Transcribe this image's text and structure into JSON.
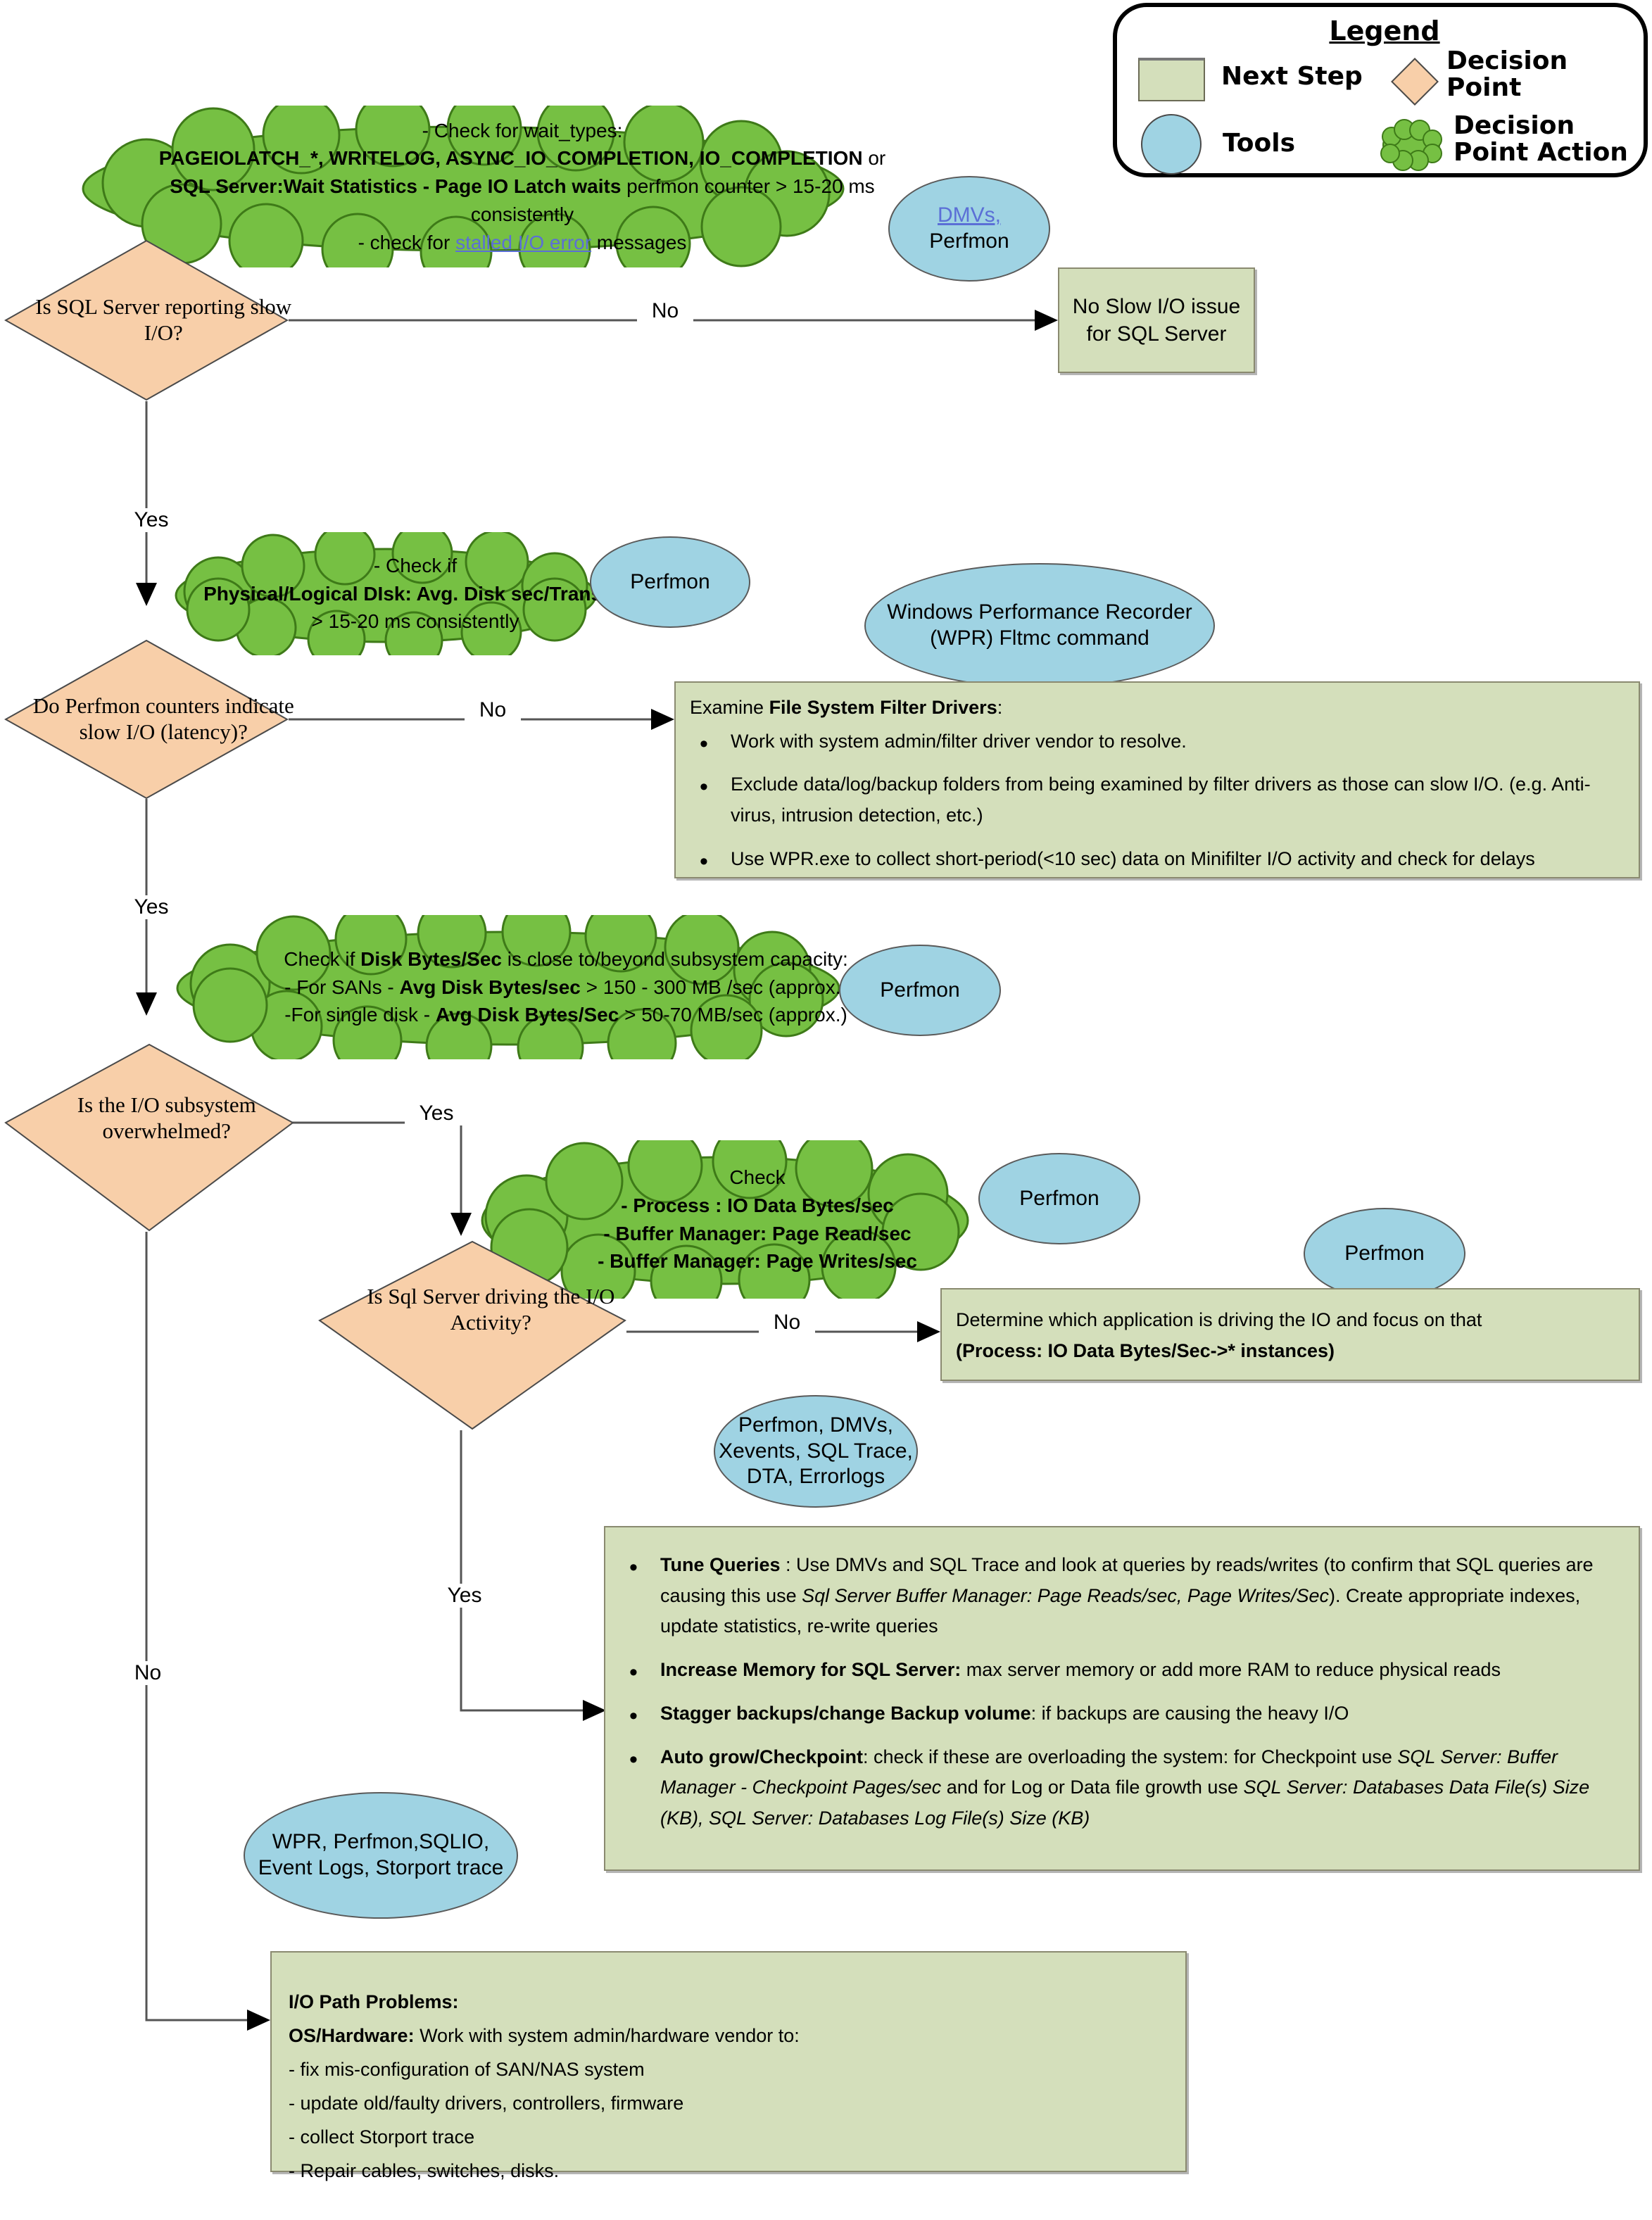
{
  "legend": {
    "title": "Legend",
    "items": [
      {
        "shape": "rect",
        "label": "Next Step"
      },
      {
        "shape": "diamond",
        "label": "Decision Point"
      },
      {
        "shape": "circle",
        "label": "Tools"
      },
      {
        "shape": "cloud",
        "label": "Decision Point Action"
      }
    ],
    "colors": {
      "next_step": "#d4dfbb",
      "tools": "#9fd3e3",
      "decision_point": "#f8cfa9",
      "decision_point_action": "#76c043"
    }
  },
  "clouds": {
    "wait_types": {
      "line1": "- Check for wait_types:",
      "line2_bold": "PAGEIOLATCH_*,  WRITELOG, ASYNC_IO_COMPLETION, IO_COMPLETION",
      "line2_tail": " or",
      "line3_bold": "SQL Server:Wait Statistics - Page IO Latch waits",
      "line3_tail": " perfmon counter > 15-20 ms",
      "line4": "consistently",
      "line5_pre": "- check for ",
      "line5_link": "stalled I/O error",
      "line5_post": " messages"
    },
    "disk_latency": {
      "line1": "- Check if",
      "line2_bold": "Physical/Logical DIsk: Avg. Disk sec/Transfer",
      "line3": "> 15-20 ms consistently"
    },
    "disk_bytes": {
      "line1_pre": "Check if ",
      "line1_bold": "Disk Bytes/Sec",
      "line1_post": " is close to/beyond subsystem capacity:",
      "line2_pre": "- For SANs - ",
      "line2_bold": "Avg Disk Bytes/sec",
      "line2_post": " > 150 - 300 MB /sec   (approx.)",
      "line3_pre": "-For single disk - ",
      "line3_bold": "Avg Disk Bytes/Sec",
      "line3_post": " > 50-70 MB/sec (approx.)"
    },
    "sql_counters": {
      "line1": "Check",
      "line2": "- Process : IO Data Bytes/sec",
      "line3": "- Buffer Manager: Page Read/sec",
      "line4": "- Buffer Manager: Page Writes/sec"
    }
  },
  "decisions": {
    "slow_io": "Is SQL Server reporting slow I/O?",
    "perfmon_latency": "Do Perfmon counters indicate slow I/O (latency)?",
    "overwhelmed": "Is the I/O subsystem overwhelmed?",
    "sql_driving": "Is Sql Server driving the I/O Activity?"
  },
  "tools": {
    "dmvs_perfmon_link": "DMVs,",
    "dmvs_perfmon_rest": "Perfmon",
    "perfmon_1": "Perfmon",
    "wpr": "Windows Performance Recorder (WPR) Fltmc command",
    "perfmon_2": "Perfmon",
    "perfmon_3": "Perfmon",
    "perfmon_4": "Perfmon",
    "sql_tools": "Perfmon, DMVs, Xevents, SQL Trace, DTA, Errorlogs",
    "wpr_tools": "WPR, Perfmon,SQLIO, Event Logs, Storport trace"
  },
  "boxes": {
    "no_slow_io": "No Slow I/O issue for SQL Server",
    "filter_drivers": {
      "heading_pre": "Examine ",
      "heading_bold": "File System Filter Drivers",
      "heading_post": ":",
      "bullets": [
        "Work with system admin/filter driver vendor to resolve.",
        "Exclude data/log/backup folders from being examined by filter drivers as those can slow I/O. (e.g. Anti-virus, intrusion detection, etc.)",
        "Use WPR.exe to collect short-period(<10 sec) data on Minifilter I/O activity and check for delays"
      ]
    },
    "other_app": {
      "line1": "Determine which application is driving the IO and focus on that",
      "line2_bold": "(Process: IO Data Bytes/Sec->* instances)"
    },
    "tune": {
      "bullets": [
        {
          "bold": "Tune Queries",
          "text_a": " : Use DMVs and SQL Trace and look at queries by reads/writes (to   confirm that SQL queries are causing this use ",
          "italic": "Sql Server Buffer Manager: Page Reads/sec, Page Writes/Sec",
          "text_b": "). Create appropriate indexes, update statistics, re-write queries"
        },
        {
          "bold": "Increase Memory for SQL Server:",
          "text_a": " max server memory or add more RAM to reduce physical reads",
          "italic": "",
          "text_b": ""
        },
        {
          "bold": "Stagger backups/change Backup volume",
          "text_a": ": if backups are causing the heavy I/O",
          "italic": "",
          "text_b": ""
        },
        {
          "bold": "Auto grow/Checkpoint",
          "text_a": ": check if these are overloading the system: for Checkpoint use ",
          "italic": "SQL Server: Buffer Manager - Checkpoint Pages/sec",
          "text_b": " and for Log or Data file growth use ",
          "italic2": "SQL Server: Databases Data File(s) Size (KB), SQL Server: Databases Log File(s) Size (KB)"
        }
      ]
    },
    "io_path": {
      "title": "I/O Path Problems:",
      "subtitle_bold": "OS/Hardware:",
      "subtitle_rest": " Work with system admin/hardware vendor to:",
      "items": [
        "- fix mis-configuration of SAN/NAS system",
        "- update old/faulty drivers, controllers, firmware",
        "- collect Storport trace",
        "- Repair cables, switches, disks."
      ]
    }
  },
  "edge_labels": {
    "no_1": "No",
    "yes_1": "Yes",
    "no_2": "No",
    "yes_2": "Yes",
    "yes_3": "Yes",
    "no_3": "No",
    "no_4": "No",
    "yes_4": "Yes"
  }
}
